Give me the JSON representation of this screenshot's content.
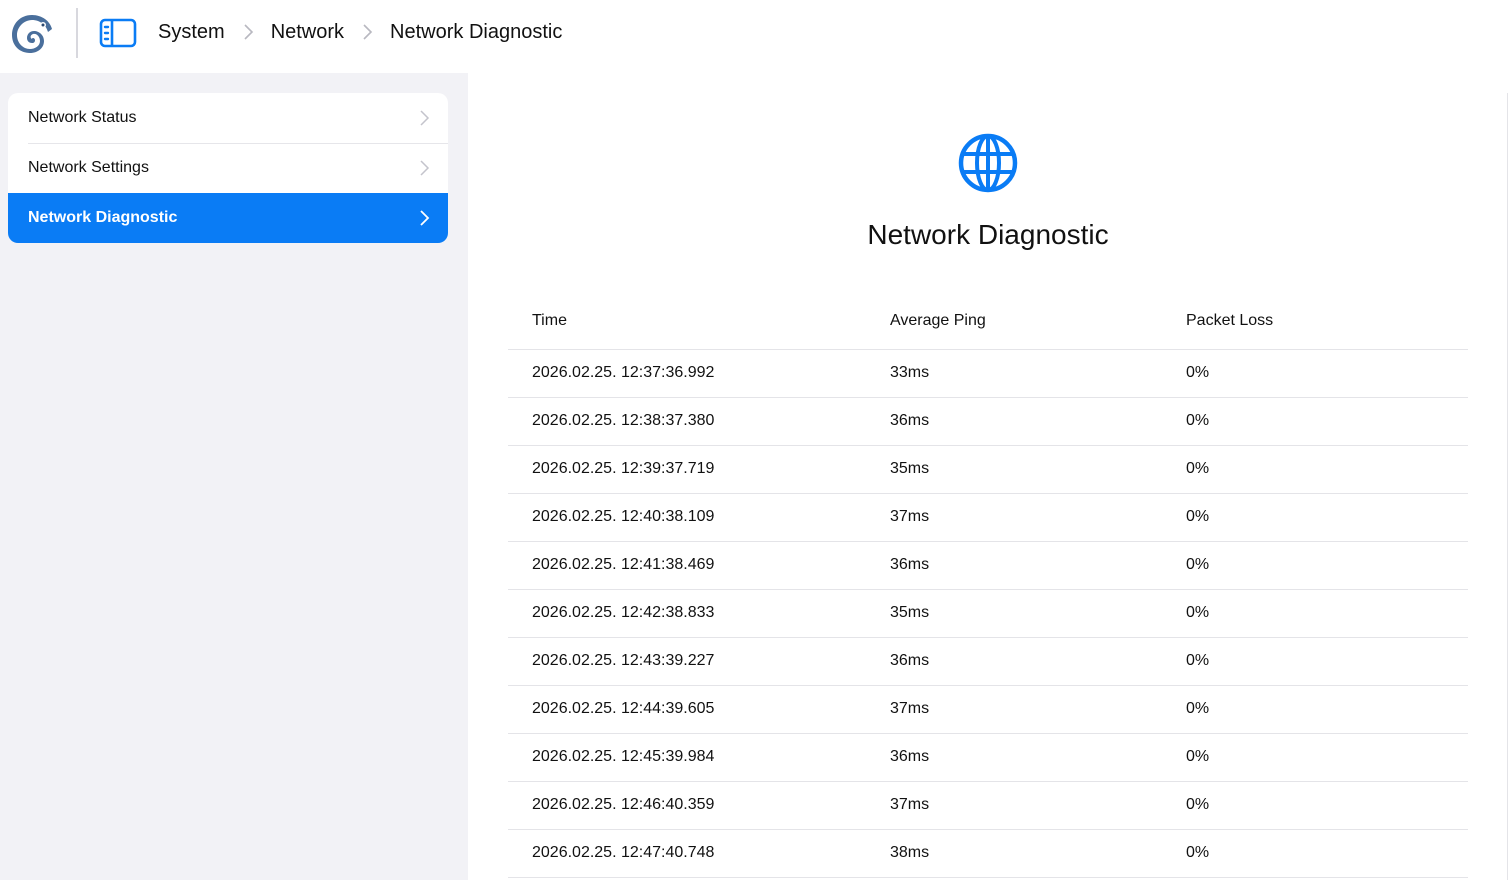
{
  "header": {
    "logo_icon": "chameleon-logo-icon",
    "sidebar_toggle_icon": "sidebar-toggle-icon",
    "breadcrumb": [
      {
        "label": "System"
      },
      {
        "label": "Network"
      },
      {
        "label": "Network Diagnostic"
      }
    ]
  },
  "sidebar": {
    "items": [
      {
        "label": "Network Status",
        "active": false
      },
      {
        "label": "Network Settings",
        "active": false
      },
      {
        "label": "Network Diagnostic",
        "active": true
      }
    ]
  },
  "main": {
    "icon": "globe-icon",
    "title": "Network Diagnostic",
    "table": {
      "columns": [
        "Time",
        "Average Ping",
        "Packet Loss"
      ],
      "rows": [
        [
          "2026.02.25. 12:37:36.992",
          "33ms",
          "0%"
        ],
        [
          "2026.02.25. 12:38:37.380",
          "36ms",
          "0%"
        ],
        [
          "2026.02.25. 12:39:37.719",
          "35ms",
          "0%"
        ],
        [
          "2026.02.25. 12:40:38.109",
          "37ms",
          "0%"
        ],
        [
          "2026.02.25. 12:41:38.469",
          "36ms",
          "0%"
        ],
        [
          "2026.02.25. 12:42:38.833",
          "35ms",
          "0%"
        ],
        [
          "2026.02.25. 12:43:39.227",
          "36ms",
          "0%"
        ],
        [
          "2026.02.25. 12:44:39.605",
          "37ms",
          "0%"
        ],
        [
          "2026.02.25. 12:45:39.984",
          "36ms",
          "0%"
        ],
        [
          "2026.02.25. 12:46:40.359",
          "37ms",
          "0%"
        ],
        [
          "2026.02.25. 12:47:40.748",
          "38ms",
          "0%"
        ]
      ]
    }
  },
  "colors": {
    "accent": "#0a7cf5",
    "sidebar_bg": "#f2f2f6",
    "logo": "#4a6f9c"
  }
}
